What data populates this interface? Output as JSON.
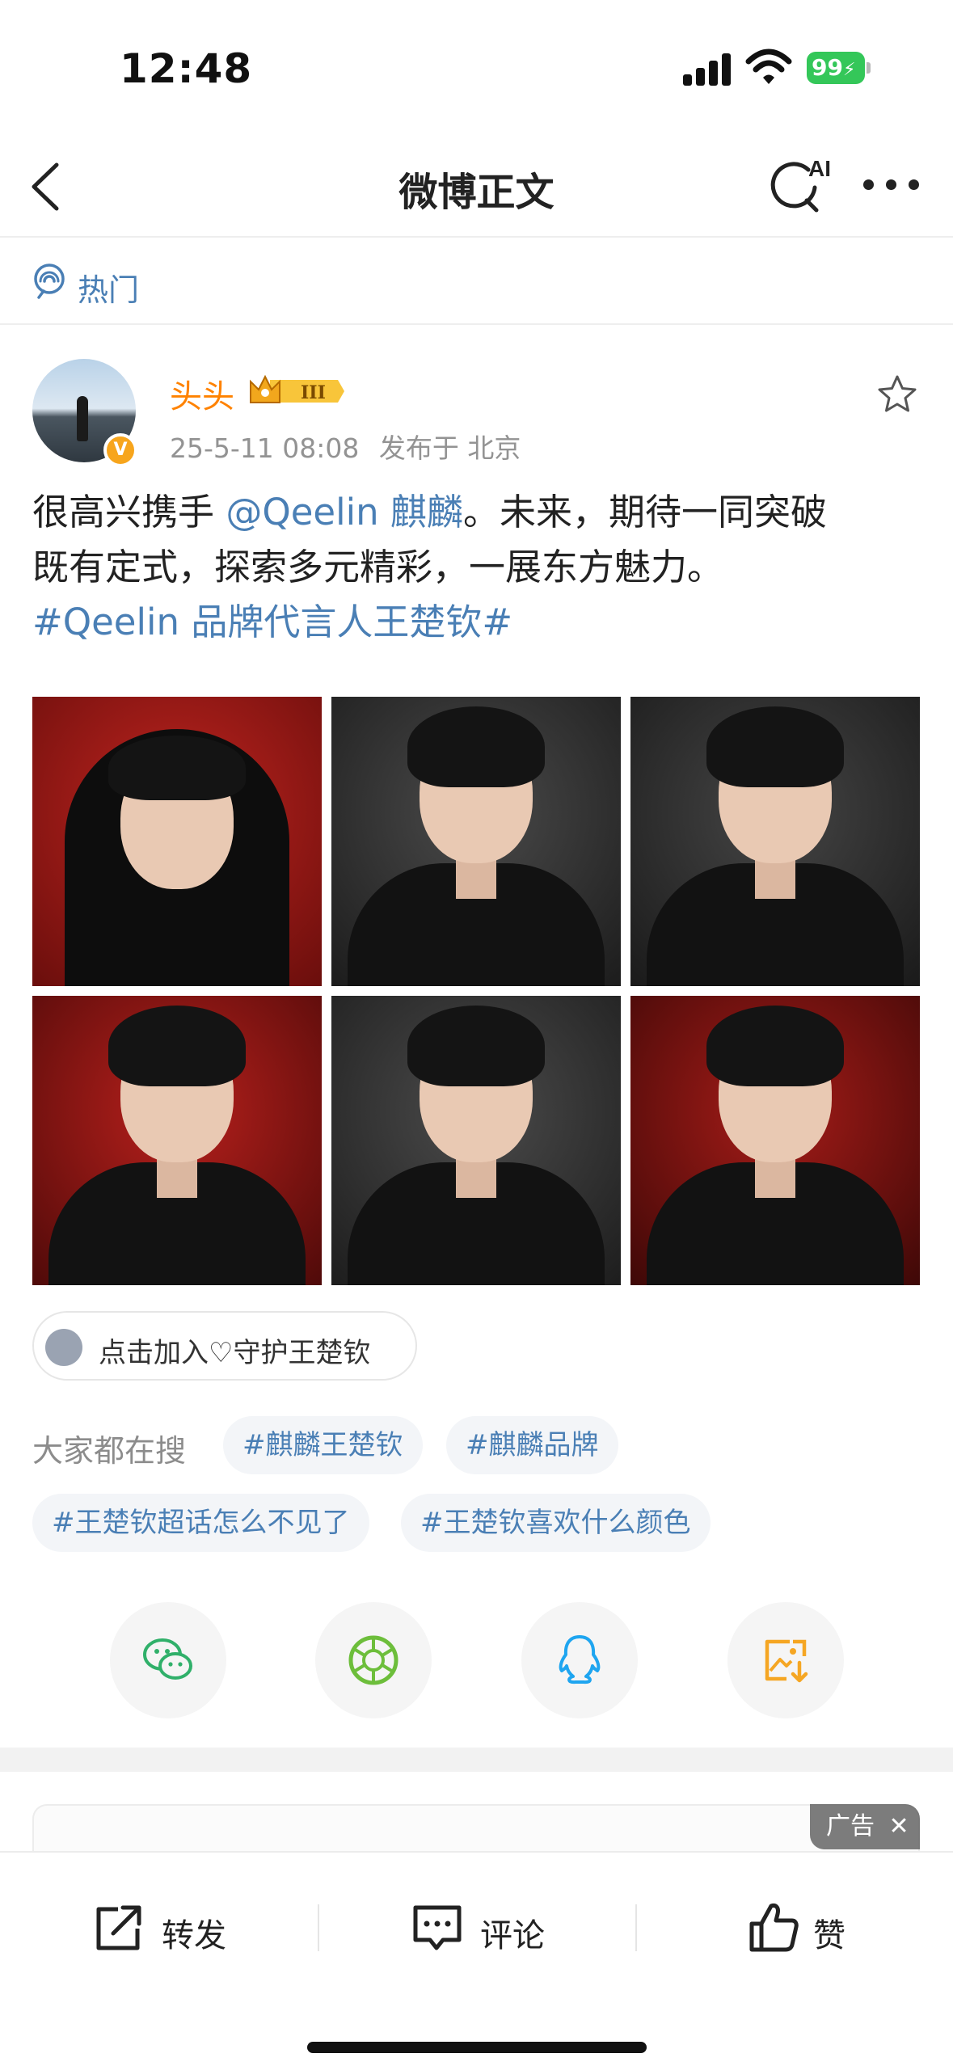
{
  "status_bar": {
    "time": "12:48",
    "battery": "99"
  },
  "nav": {
    "title": "微博正文",
    "ai_label": "AI"
  },
  "hot": {
    "label": "热门"
  },
  "post": {
    "username": "头头",
    "level": "III",
    "timestamp": "25-5-11 08:08",
    "location": "发布于 北京",
    "text_line1_prefix": "很高兴携手 ",
    "mention": "@Qeelin 麒麟",
    "text_line1_suffix": "。未来，期待一同突破",
    "text_line2": "既有定式，探索多元精彩，一展东方魅力。",
    "hashtag": "#Qeelin 品牌代言人王楚钦#",
    "photo_count": 6
  },
  "supertopic": {
    "label": "点击加入♡守护王楚钦"
  },
  "search": {
    "label": "大家都在搜",
    "tags": [
      "#麒麟王楚钦",
      "#麒麟品牌",
      "#王楚钦超话怎么不见了",
      "#王楚钦喜欢什么颜色"
    ]
  },
  "share": {
    "icons": [
      "wechat-icon",
      "moments-icon",
      "qq-icon",
      "save-image-icon"
    ]
  },
  "ad": {
    "badge": "广告"
  },
  "actions": {
    "repost": "转发",
    "comment": "评论",
    "like": "赞"
  },
  "colors": {
    "link": "#4a7fb5",
    "username": "#ff8200",
    "battery": "#34c759"
  }
}
